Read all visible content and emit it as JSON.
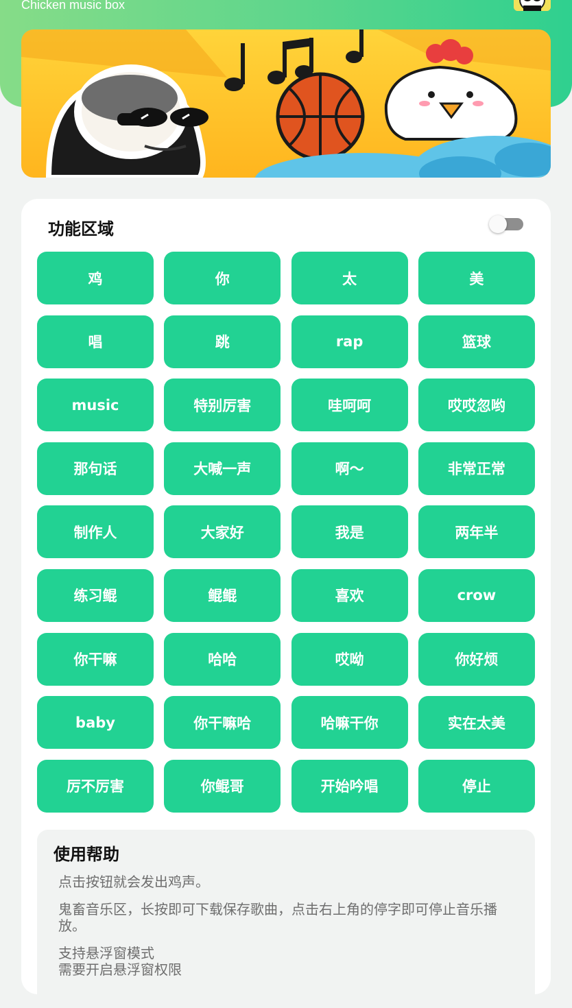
{
  "header": {
    "subtitle": "Chicken music box",
    "accent_gradient": [
      "#86dc88",
      "#2fd08f"
    ],
    "avatar_icon": "panda-meme-avatar"
  },
  "banner": {
    "illustration": [
      "panda-meme-sunglasses",
      "music-notes",
      "basketball",
      "cartoon-chicken",
      "clouds"
    ]
  },
  "panel": {
    "title": "功能区域",
    "toggle_on": false
  },
  "buttons": [
    "鸡",
    "你",
    "太",
    "美",
    "唱",
    "跳",
    "rap",
    "篮球",
    "music",
    "特别厉害",
    "哇呵呵",
    "哎哎忽哟",
    "那句话",
    "大喊一声",
    "啊～",
    "非常正常",
    "制作人",
    "大家好",
    "我是",
    "两年半",
    "练习鲲",
    "鲲鲲",
    "喜欢",
    "crow",
    "你干嘛",
    "哈哈",
    "哎呦",
    "你好烦",
    "baby",
    "你干嘛哈",
    "哈嘛干你",
    "实在太美",
    "厉不厉害",
    "你鲲哥",
    "开始吟唱",
    "停止"
  ],
  "help": {
    "title": "使用帮助",
    "paragraphs": [
      "点击按钮就会发出鸡声。",
      "鬼畜音乐区，长按即可下载保存歌曲，点击右上角的停字即可停止音乐播放。",
      "支持悬浮窗模式\n需要开启悬浮窗权限"
    ]
  },
  "colors": {
    "button": "#22d293",
    "button_text": "#ffffff",
    "page_bg": "#f1f3f2"
  }
}
